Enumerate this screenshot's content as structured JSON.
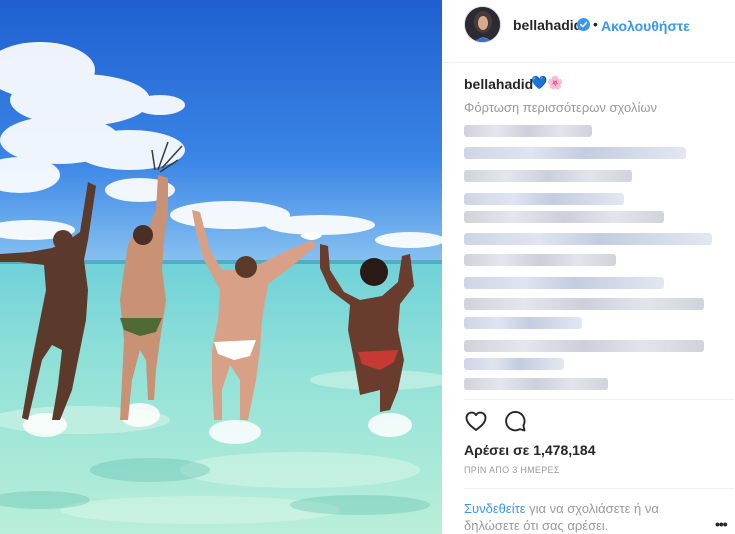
{
  "header": {
    "username": "bellahadid",
    "verified_icon": "verified-badge-icon",
    "separator": "•",
    "follow_label": "Ακολουθήστε"
  },
  "caption": {
    "username": "bellahadid",
    "emoji_heart": "💙",
    "emoji_flower": "🌸",
    "load_more": "Φόρτωση περισσότερων σχολίων"
  },
  "actions": {
    "like_icon": "heart-outline-icon",
    "comment_icon": "comment-bubble-icon",
    "likes_text": "Αρέσει σε 1,478,184",
    "timestamp": "ΠΡΙΝ ΑΠΟ 3 ΗΜΕΡΕΣ"
  },
  "footer": {
    "login_link": "Συνδεθείτε",
    "login_rest": " για να σχολιάσετε ή να δηλώσετε ότι σας αρέσει.",
    "more_icon": "more-options-icon",
    "more": "•••"
  },
  "colors": {
    "link": "#3897f0",
    "muted": "#999999",
    "text": "#262626"
  }
}
